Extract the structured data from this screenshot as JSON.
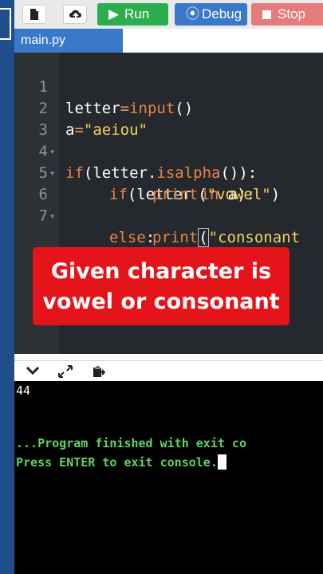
{
  "toolbar": {
    "new_icon": "new-file-icon",
    "upload_icon": "upload-cloud-icon",
    "run_label": "Run",
    "debug_label": "Debug",
    "stop_label": "Stop",
    "colors": {
      "run": "#2bae4f",
      "debug": "#3a78c9",
      "stop": "#e57b7b"
    }
  },
  "tab": {
    "label": "main.py"
  },
  "editor": {
    "lines": [
      {
        "num": "1",
        "fold": ""
      },
      {
        "num": "2",
        "fold": ""
      },
      {
        "num": "3",
        "fold": "▾"
      },
      {
        "num": "4",
        "fold": "▾"
      },
      {
        "num": "5",
        "fold": ""
      },
      {
        "num": "6",
        "fold": "▾"
      },
      {
        "num": "7",
        "fold": ""
      }
    ],
    "tokens": {
      "l1a": "letter",
      "l1b": "=",
      "l1c": "input",
      "l1d": "()",
      "l2a": "a",
      "l2b": "=",
      "l2c": "\"aeiou\"",
      "l3a": "if",
      "l3b": "(letter.",
      "l3c": "isalpha",
      "l3d": "()):",
      "l4a": "if",
      "l4b": "(letter ",
      "l4c": "in",
      "l4d": " a):",
      "l5a": "print",
      "l5b": "(",
      "l5c": "\"vowel\"",
      "l5d": ")",
      "l6a": "else",
      "l6b": ":",
      "l7a": "print",
      "l7b": "(",
      "l7c": "\"consonant"
    }
  },
  "banner": {
    "line1": "Given character is",
    "line2": "vowel or consonant"
  },
  "console": {
    "line1": "44",
    "line2": "...Program finished with exit co",
    "line3": "Press ENTER to exit console."
  }
}
